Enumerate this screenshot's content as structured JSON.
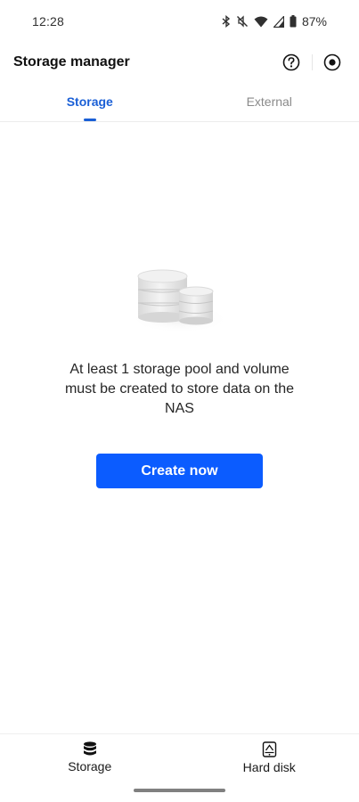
{
  "status_bar": {
    "time": "12:28",
    "battery_percent": "87%",
    "icons": [
      "bluetooth-icon",
      "mute-icon",
      "wifi-icon",
      "cell-signal-icon",
      "battery-icon"
    ]
  },
  "header": {
    "title": "Storage manager",
    "actions": [
      "help-icon",
      "record-icon"
    ]
  },
  "tabs": [
    {
      "label": "Storage",
      "active": true
    },
    {
      "label": "External",
      "active": false
    }
  ],
  "empty_state": {
    "illustration": "storage-pool-illustration",
    "message": "At least 1 storage pool and volume must be created to store data on the NAS",
    "button_label": "Create now"
  },
  "bottom_nav": [
    {
      "label": "Storage",
      "icon": "database-icon",
      "active": true
    },
    {
      "label": "Hard disk",
      "icon": "hard-disk-icon",
      "active": false
    }
  ],
  "colors": {
    "accent": "#1a5fd6",
    "button": "#0b5cff",
    "inactive_tab": "#8a8a8a"
  }
}
